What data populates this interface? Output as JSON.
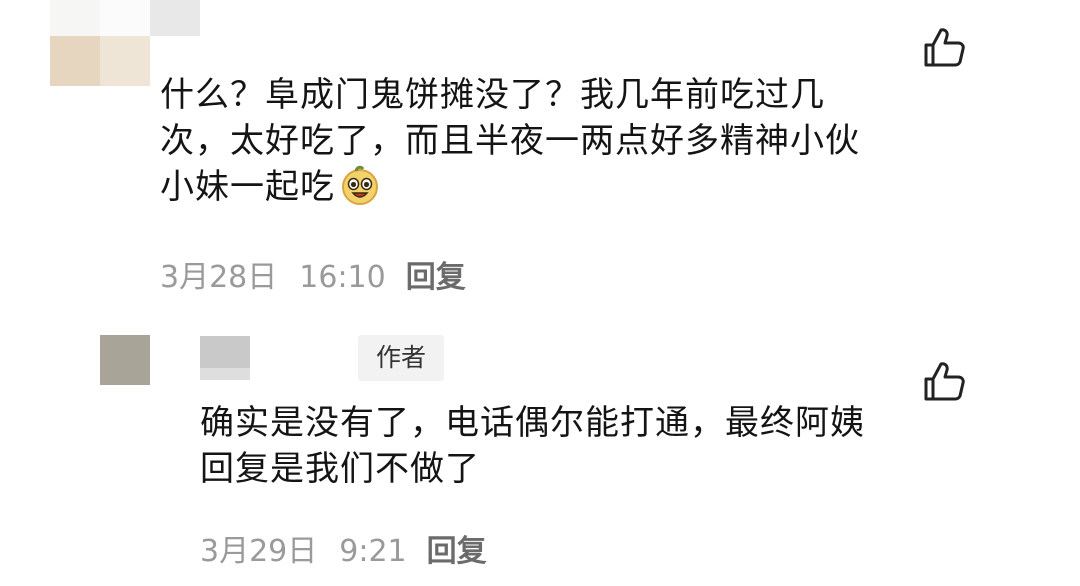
{
  "comments": [
    {
      "text_lines": [
        "什么？阜成门鬼饼摊没了？我几年前吃过几",
        "次，太好吃了，而且半夜一两点好多精神小伙",
        "小妹一起吃"
      ],
      "emoji": "grinning-face-emoji",
      "date": "3月28日",
      "time": "16:10",
      "reply_label": "回复"
    },
    {
      "author_badge": "作者",
      "text_lines": [
        "确实是没有了，电话偶尔能打通，最终阿姨",
        "回复是我们不做了"
      ],
      "date": "3月29日",
      "time": "9:21",
      "reply_label": "回复"
    }
  ],
  "icons": {
    "like": "thumbs-up-icon",
    "avatar": "avatar-blurred"
  },
  "colors": {
    "text": "#141414",
    "meta": "#9a9a9a",
    "reply": "#6b6b6b",
    "badge_bg": "#f2f2f2"
  }
}
